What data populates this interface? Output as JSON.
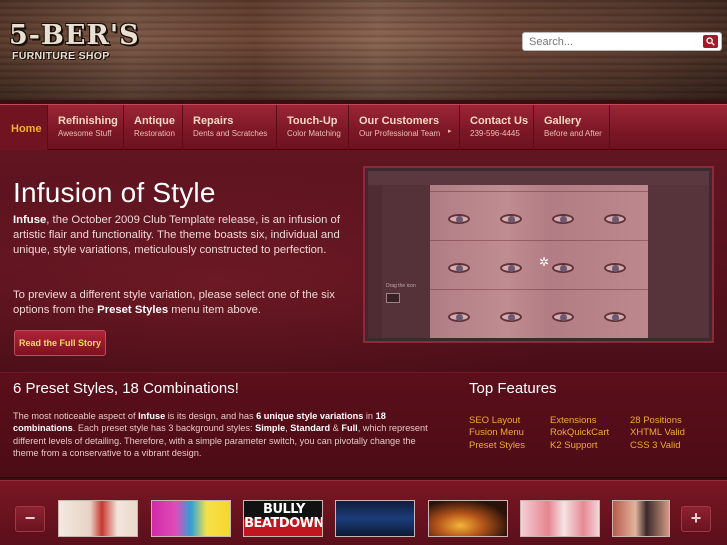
{
  "logo": {
    "main": "5-BER'S",
    "sub": "FURNITURE SHOP"
  },
  "search": {
    "placeholder": "Search..."
  },
  "nav": [
    {
      "title": "Home",
      "subtitle": ""
    },
    {
      "title": "Refinishing",
      "subtitle": "Awesome Stuff"
    },
    {
      "title": "Antique",
      "subtitle": "Restoration"
    },
    {
      "title": "Repairs",
      "subtitle": "Dents and Scratches"
    },
    {
      "title": "Touch-Up",
      "subtitle": "Color Matching"
    },
    {
      "title": "Our Customers",
      "subtitle": "Our Professional Team"
    },
    {
      "title": "Contact Us",
      "subtitle": "239-596-4445"
    },
    {
      "title": "Gallery",
      "subtitle": "Before and After"
    }
  ],
  "hero": {
    "title": "Infusion of Style",
    "p1_bold": "Infuse",
    "p1_rest": ", the October 2009 Club Template release, is an infusion of artistic flair and functionality. The theme boasts six, individual and unique, style variations, meticulously constructed to perfection.",
    "p2_start": "To preview a different style variation, please select one of the six options from the ",
    "p2_bold": "Preset Styles",
    "p2_end": " menu item above.",
    "button": "Read the Full Story",
    "image_caption": "Drag the icon"
  },
  "section": {
    "title": "6 Preset Styles, 18 Combinations!",
    "t1": "The most noticeable aspect of ",
    "b1": "Infuse",
    "t2": " is its design, and has ",
    "b2": "6 unique style variations",
    "t3": " in ",
    "b3": "18 combinations",
    "t4": ". Each preset style has 3 background styles: ",
    "b4": "Simple",
    "t5": ", ",
    "b5": "Standard",
    "t6": " & ",
    "b6": "Full",
    "t7": ", which represent different levels of detailing. Therefore, with a simple parameter switch, you can pivotally change the theme from a conservative to a vibrant design."
  },
  "features": {
    "title": "Top Features",
    "items": [
      "SEO Layout",
      "Extensions",
      "28 Positions",
      "Fusion Menu",
      "RokQuickCart",
      "XHTML Valid",
      "Preset Styles",
      "K2 Support",
      "CSS 3 Valid"
    ]
  },
  "carousel": {
    "prev": "−",
    "next": "+",
    "thumbs": [
      "",
      "",
      "BULLY BEATDOWN",
      "",
      "",
      "",
      ""
    ]
  },
  "colors": {
    "accent": "#f2b02d",
    "nav": "#8b1f2e",
    "link": "#f0a933"
  }
}
